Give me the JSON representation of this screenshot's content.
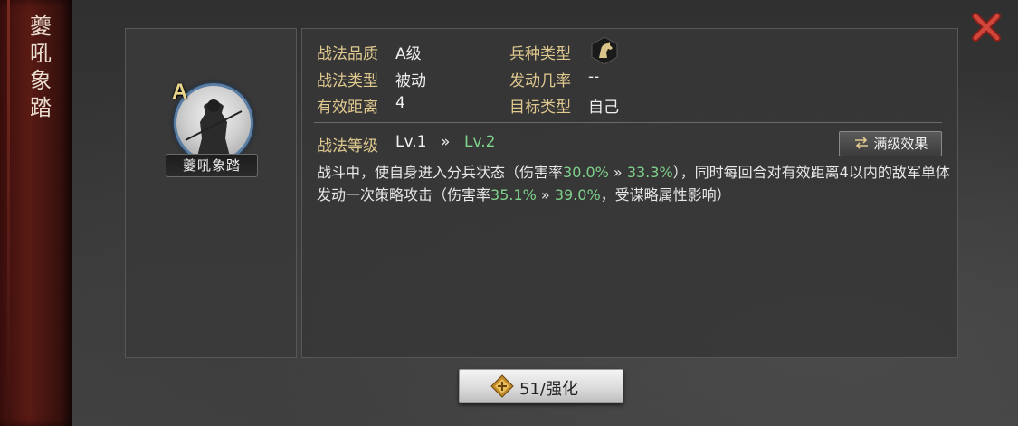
{
  "skill": {
    "title_chars": [
      "夔",
      "吼",
      "象",
      "踏"
    ],
    "name": "夔吼象踏",
    "grade_badge": "A"
  },
  "info": {
    "quality_label": "战法品质",
    "quality_value": "A级",
    "type_label": "战法类型",
    "type_value": "被动",
    "range_label": "有效距离",
    "range_value": "4",
    "troop_label": "兵种类型",
    "troop_icon": "cavalry-horse-icon",
    "rate_label": "发动几率",
    "rate_value": "--",
    "target_label": "目标类型",
    "target_value": "自己"
  },
  "level": {
    "label": "战法等级",
    "current": "Lv.1",
    "arrow": "»",
    "next": "Lv.2",
    "max_button": "满级效果"
  },
  "description": {
    "p1": "战斗中，使自身进入分兵状态（伤害率",
    "v1a": "30.0%",
    "arrow1": " » ",
    "v1b": "33.3%",
    "p2": "），同时每回合对有效距离4以内的敌军单体发动一次策略攻击（伤害率",
    "v2a": "35.1%",
    "arrow2": " » ",
    "v2b": "39.0%",
    "p3": "，受谋略属性影响）"
  },
  "upgrade": {
    "label": "51/强化",
    "icon": "upgrade-token-icon"
  },
  "colors": {
    "gold_label": "#e0c98f",
    "green_value": "#7fd18b",
    "close_red": "#c0392b"
  }
}
